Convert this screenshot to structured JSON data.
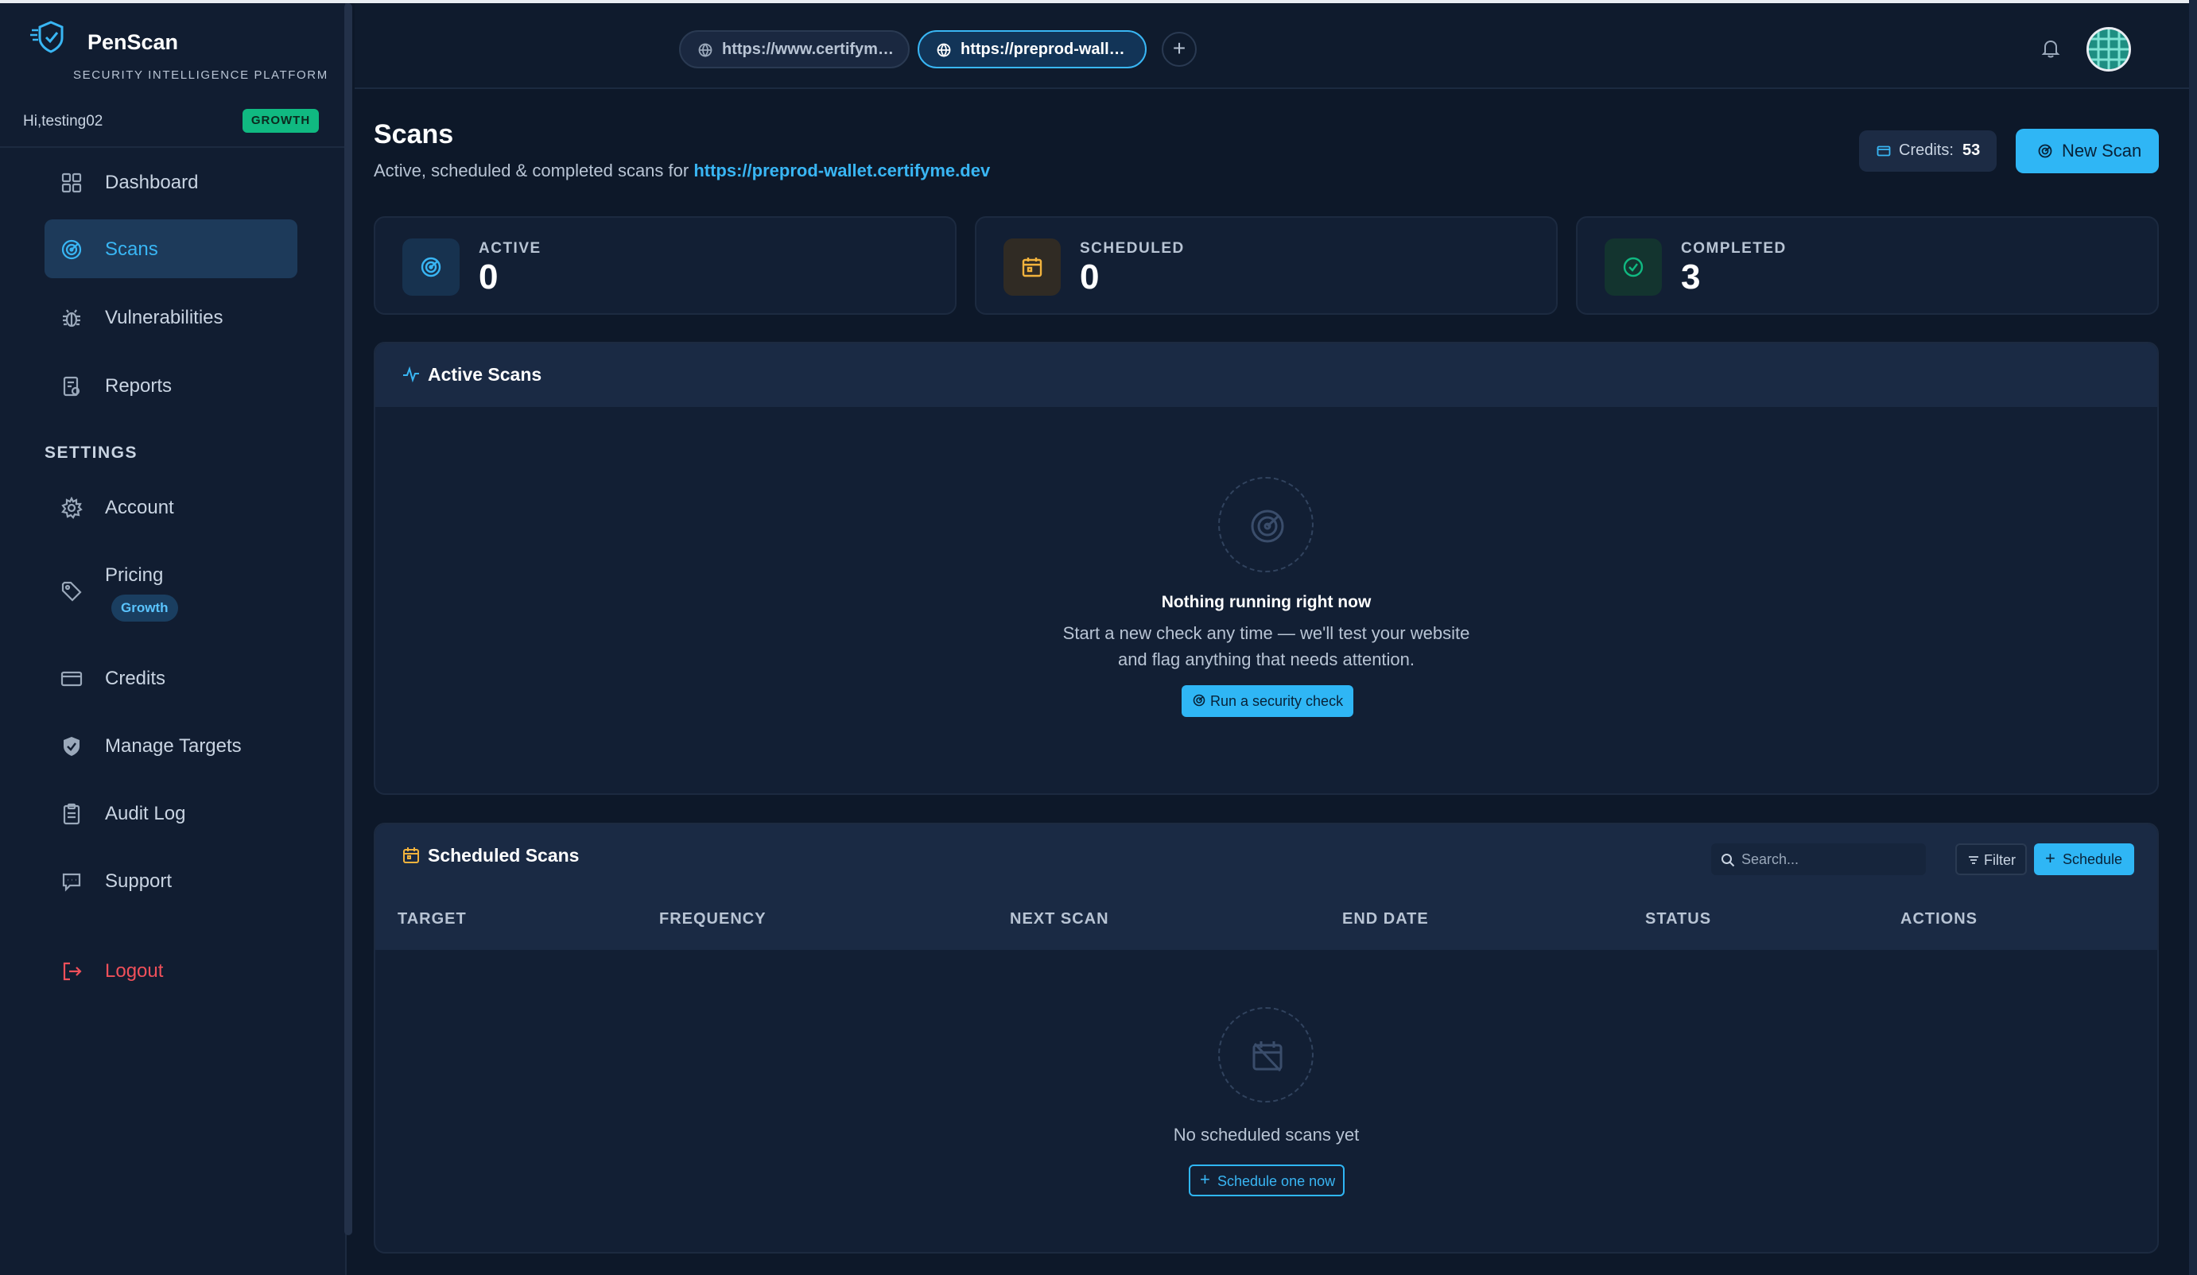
{
  "brand": {
    "name": "PenScan",
    "subtitle": "SECURITY INTELLIGENCE PLATFORM"
  },
  "user": {
    "greeting": "Hi,testing02",
    "plan_badge": "GROWTH"
  },
  "sidebar": {
    "items": [
      {
        "label": "Dashboard",
        "icon": "grid-icon"
      },
      {
        "label": "Scans",
        "icon": "radar-icon",
        "active": true
      },
      {
        "label": "Vulnerabilities",
        "icon": "bug-icon"
      },
      {
        "label": "Reports",
        "icon": "report-icon"
      }
    ],
    "settings_heading": "SETTINGS",
    "settings_items": [
      {
        "label": "Account",
        "icon": "gear-icon"
      },
      {
        "label": "Pricing",
        "icon": "tag-icon",
        "badge": "Growth"
      },
      {
        "label": "Credits",
        "icon": "credit-card-icon"
      },
      {
        "label": "Manage Targets",
        "icon": "shield-icon"
      },
      {
        "label": "Audit Log",
        "icon": "clipboard-icon"
      },
      {
        "label": "Support",
        "icon": "chat-icon"
      }
    ],
    "logout_label": "Logout"
  },
  "topbar": {
    "tabs": [
      {
        "label": "https://www.certifym…",
        "active": false
      },
      {
        "label": "https://preprod-wall…",
        "active": true
      }
    ],
    "add_tab": "+"
  },
  "page": {
    "title": "Scans",
    "subtitle_prefix": "Active, scheduled & completed scans for ",
    "subtitle_link": "https://preprod-wallet.certifyme.dev",
    "credits_label": "Credits:",
    "credits_value": "53",
    "new_scan_label": "New Scan"
  },
  "stats": [
    {
      "label": "ACTIVE",
      "value": "0",
      "color": "#39b6f4"
    },
    {
      "label": "SCHEDULED",
      "value": "0",
      "color": "#f2b33d"
    },
    {
      "label": "COMPLETED",
      "value": "3",
      "color": "#10b981"
    }
  ],
  "active_scans": {
    "title": "Active Scans",
    "empty_title": "Nothing running right now",
    "empty_line1": "Start a new check any time — we'll test your website",
    "empty_line2": "and flag anything that needs attention.",
    "run_button": "Run a security check"
  },
  "scheduled_scans": {
    "title": "Scheduled Scans",
    "search_placeholder": "Search...",
    "filter_label": "Filter",
    "schedule_label": "Schedule",
    "columns": [
      "TARGET",
      "FREQUENCY",
      "NEXT SCAN",
      "END DATE",
      "STATUS",
      "ACTIONS"
    ],
    "empty_text": "No scheduled scans yet",
    "schedule_now_label": "Schedule one now"
  },
  "colors": {
    "accent": "#2fb6f5",
    "success": "#10b981",
    "warning": "#f2b33d",
    "danger": "#f0505a",
    "background": "#0d1829"
  }
}
